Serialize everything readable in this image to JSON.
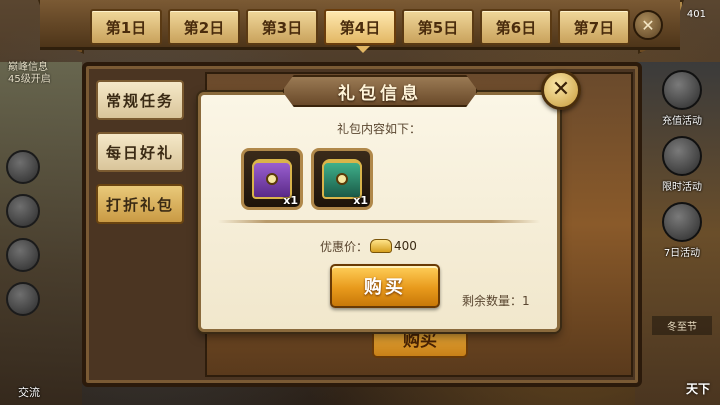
{
  "tabs": [
    {
      "label": "第1日"
    },
    {
      "label": "第2日"
    },
    {
      "label": "第3日"
    },
    {
      "label": "第4日"
    },
    {
      "label": "第5日"
    },
    {
      "label": "第6日"
    },
    {
      "label": "第7日"
    }
  ],
  "active_tab_index": 3,
  "top_counter": "401",
  "background": {
    "left_hint": "巅峰信息\n45级开启",
    "left_bottom_label": "交流",
    "right_icons": [
      {
        "label": "充值活动",
        "icon": "recharge-icon"
      },
      {
        "label": "限时活动",
        "icon": "limited-event-icon"
      },
      {
        "label": "7日活动",
        "icon": "seven-day-icon"
      }
    ],
    "right_bottom_label": "冬至节",
    "corner_label": "天下"
  },
  "side_menu": [
    {
      "label": "常规任务"
    },
    {
      "label": "每日好礼"
    },
    {
      "label": "打折礼包"
    }
  ],
  "active_side_index": 2,
  "underlying_buy_label": "购买",
  "modal": {
    "title": "礼包信息",
    "subtitle": "礼包内容如下：",
    "items": [
      {
        "icon": "purple-treasure-chest-icon",
        "count": "x1"
      },
      {
        "icon": "green-treasure-chest-icon",
        "count": "x1"
      }
    ],
    "price_label": "优惠价：",
    "price_value": "400",
    "currency_icon": "gold-ingot-icon",
    "buy_label": "购买",
    "remaining_label": "剩余数量：1"
  },
  "colors": {
    "chest_purple": "#8a4fc0",
    "chest_green": "#2f9a7a",
    "button_gold": "#e89a1c"
  }
}
